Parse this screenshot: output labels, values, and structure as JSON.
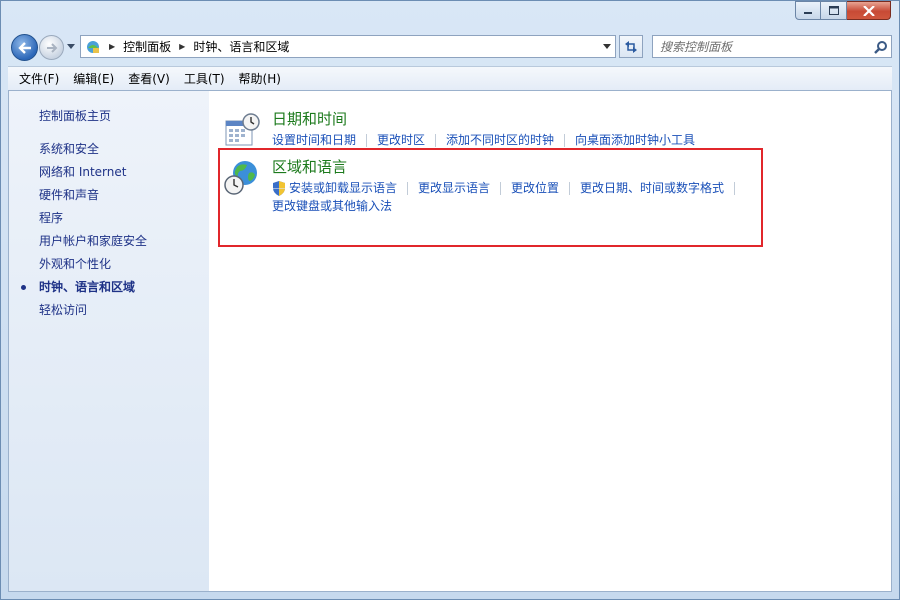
{
  "window": {
    "caption_icons": [
      "minimize-icon",
      "maximize-icon",
      "close-icon"
    ]
  },
  "nav": {
    "breadcrumbs": [
      "控制面板",
      "时钟、语言和区域"
    ],
    "search_placeholder": "搜索控制面板"
  },
  "menu": {
    "items": [
      "文件(F)",
      "编辑(E)",
      "查看(V)",
      "工具(T)",
      "帮助(H)"
    ]
  },
  "sidebar": {
    "home": "控制面板主页",
    "items": [
      "系统和安全",
      "网络和 Internet",
      "硬件和声音",
      "程序",
      "用户帐户和家庭安全",
      "外观和个性化",
      "时钟、语言和区域",
      "轻松访问"
    ],
    "active_index": 6
  },
  "categories": [
    {
      "title": "日期和时间",
      "icon": "calendar-clock-icon",
      "links": [
        "设置时间和日期",
        "更改时区",
        "添加不同时区的时钟",
        "向桌面添加时钟小工具"
      ]
    },
    {
      "title": "区域和语言",
      "icon": "globe-clock-icon",
      "links": [
        "安装或卸载显示语言",
        "更改显示语言",
        "更改位置",
        "更改日期、时间或数字格式",
        "更改键盘或其他输入法"
      ],
      "shield_link_index": 0
    }
  ],
  "colors": {
    "link": "#1a50b8",
    "category_title": "#1c7a1c",
    "highlight": "#e1262b",
    "sidebar_text": "#1e3287"
  }
}
